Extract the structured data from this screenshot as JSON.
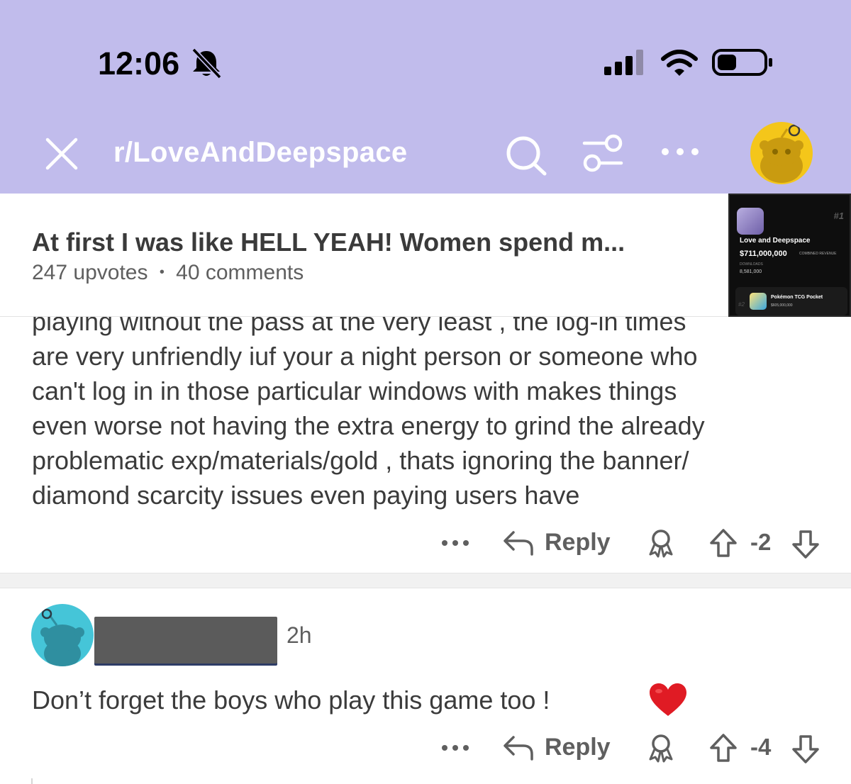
{
  "colors": {
    "header_bg": "#c1bcec",
    "header_fg": "#ffffff",
    "avatar_yellow": "#f4c61a",
    "avatar_teal": "#45c5d8",
    "heart": "#e01b24"
  },
  "status_bar": {
    "time": "12:06",
    "icons": [
      "bell-slash-icon",
      "cellular-signal-icon",
      "wifi-icon",
      "battery-icon"
    ]
  },
  "header": {
    "subreddit": "r/LoveAndDeepspace",
    "icons": [
      "close-icon",
      "search-icon",
      "filter-icon",
      "more-icon",
      "avatar"
    ]
  },
  "post": {
    "title": "At first I was like HELL YEAH! Women spend m...",
    "upvotes": "247 upvotes",
    "separator": "•",
    "comments": "40 comments"
  },
  "overlay": {
    "rank1": "#1",
    "name1": "Love and Deepspace",
    "revenue1": "$711,000,000",
    "revenue_label": "COMBINED REVENUE",
    "downloads_label": "DOWNLOADS",
    "downloads1": "8,581,000",
    "rank2": "#2",
    "name2": "Pokémon TCG Pocket",
    "revenue2": "$605,000,000"
  },
  "comments": [
    {
      "lines": [
        "playing without the pass at the very least , the log-in times",
        "are very unfriendly iuf your a night person or someone who",
        "can't log in in those particular windows with makes things",
        "even worse not having the extra energy to grind the already",
        "problematic exp/materials/gold , thats ignoring the banner/",
        "diamond scarcity issues even paying users have"
      ],
      "reply_label": "Reply",
      "score": "-2"
    },
    {
      "time": "2h",
      "text": "Don’t forget the boys who play this game too ! ",
      "emoji": "heart-icon",
      "reply_label": "Reply",
      "score": "-4"
    }
  ]
}
